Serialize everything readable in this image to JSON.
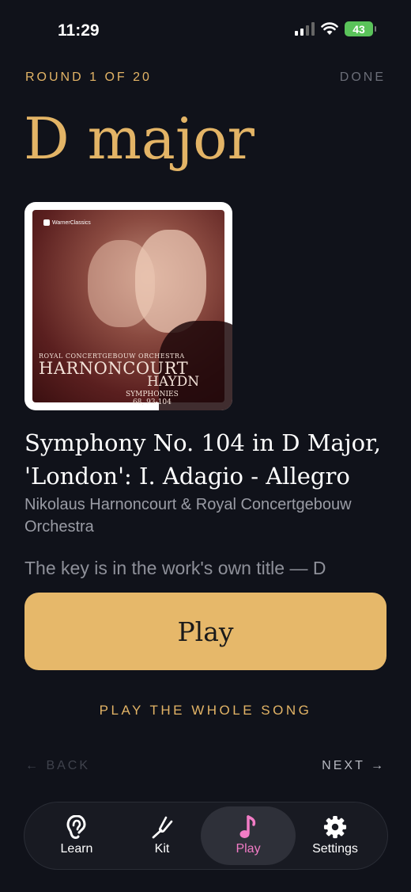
{
  "status": {
    "time": "11:29",
    "battery": "43"
  },
  "header": {
    "round": "ROUND 1 OF 20",
    "done": "DONE"
  },
  "key": "D major",
  "album": {
    "brand": "WarnerClassics",
    "orchestra": "ROYAL CONCERTGEBOUW ORCHESTRA",
    "conductor": "HARNONCOURT",
    "composer": "HAYDN",
    "symphonies": "SYMPHONIES",
    "numbers": "68, 93-104"
  },
  "track": {
    "title": "Symphony No. 104 in D Major, 'London': I. Adagio - Allegro",
    "artist": "Nikolaus Harnoncourt & Royal Concertgebouw Orchestra",
    "description": "The key is in the work's own title — D"
  },
  "controls": {
    "play": "Play",
    "play_whole": "PLAY THE WHOLE SONG",
    "back": "← BACK",
    "next": "NEXT →"
  },
  "tabs": [
    {
      "label": "Learn",
      "icon": "ear-icon"
    },
    {
      "label": "Kit",
      "icon": "tuning-fork-icon"
    },
    {
      "label": "Play",
      "icon": "music-note-icon",
      "active": true
    },
    {
      "label": "Settings",
      "icon": "gear-icon"
    }
  ],
  "colors": {
    "accent": "#e3b466",
    "background": "#10121a",
    "active_tab": "#f27cc6"
  }
}
